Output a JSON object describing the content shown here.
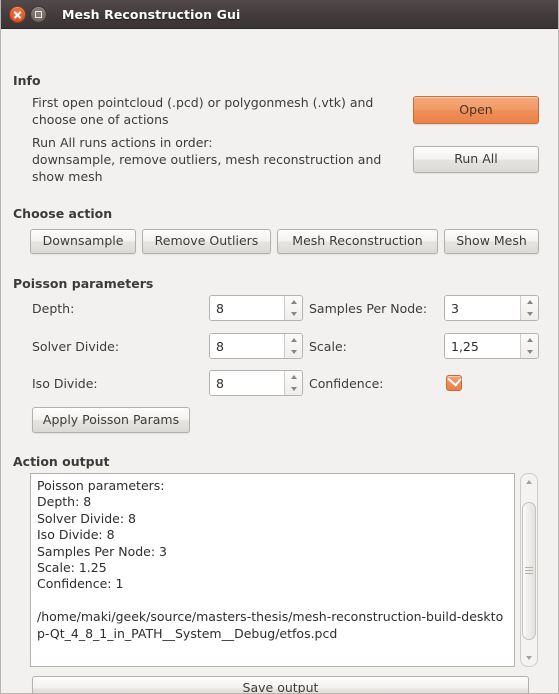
{
  "window": {
    "title": "Mesh Reconstruction Gui",
    "close_icon": "close-icon",
    "maximize_icon": "maximize-icon",
    "accent_color": "#ee8f57",
    "titlebar_color": "#413a3b",
    "background_color": "#f2f1f0"
  },
  "info": {
    "group_label": "Info",
    "line1": "First open pointcloud (.pcd) or polygonmesh (.vtk) and\nchoose one of actions",
    "line2": "Run All runs actions in order:\ndownsample, remove outliers, mesh reconstruction and\nshow mesh",
    "open_button": "Open",
    "run_all_button": "Run All"
  },
  "choose_action": {
    "group_label": "Choose action",
    "buttons": [
      {
        "label": "Downsample"
      },
      {
        "label": "Remove Outliers"
      },
      {
        "label": "Mesh Reconstruction"
      },
      {
        "label": "Show Mesh"
      }
    ]
  },
  "poisson": {
    "group_label": "Poisson parameters",
    "fields": [
      {
        "label": "Depth:",
        "value": "8"
      },
      {
        "label": "Solver Divide:",
        "value": "8"
      },
      {
        "label": "Iso Divide:",
        "value": "8"
      },
      {
        "label": "Samples Per Node:",
        "value": "3"
      },
      {
        "label": "Scale:",
        "value": "1,25"
      }
    ],
    "confidence_label": "Confidence:",
    "confidence_checked": true,
    "apply_button": "Apply Poisson Params"
  },
  "action_output": {
    "group_label": "Action output",
    "text": "Poisson parameters:\nDepth: 8\nSolver Divide: 8\nIso Divide: 8\nSamples Per Node: 3\nScale: 1.25\nConfidence: 1\n\n/home/maki/geek/source/masters-thesis/mesh-reconstruction-build-desktop-Qt_4_8_1_in_PATH__System__Debug/etfos.pcd",
    "save_button": "Save output"
  }
}
